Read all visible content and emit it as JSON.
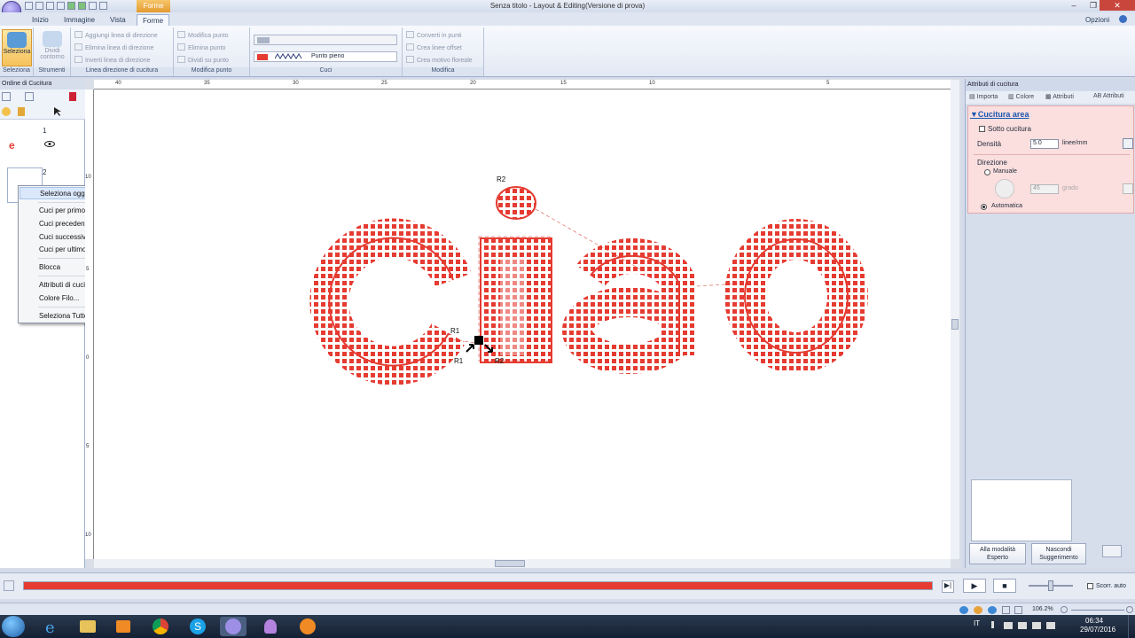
{
  "window": {
    "title": "Senza titolo - Layout & Editing(Versione di prova)",
    "context_tab": "Forme",
    "minimize": "–",
    "restore": "❐",
    "close": "✕"
  },
  "ribbon_tabs": [
    "Inizio",
    "Immagine",
    "Vista",
    "Forme"
  ],
  "options_label": "Opzioni",
  "ribbon": {
    "seleziona": {
      "label": "Seleziona",
      "group": "Seleziona"
    },
    "strumenti": {
      "label": "Dividi contorno",
      "group": "Strumenti"
    },
    "linea_direzione": {
      "items": [
        "Aggiungi linea di direzione",
        "Elimina linea di direzione",
        "Inverti linea di direzione"
      ],
      "group": "Linea direzione di cucitura"
    },
    "modifica_punto": {
      "items": [
        "Modifica punto",
        "Elimina punto",
        "Dividi su punto"
      ],
      "group": "Modifica punto"
    },
    "cuci": {
      "stitch_type": "Punto pieno",
      "group": "Cuci"
    },
    "modifica": {
      "items": [
        "Converti in punti",
        "Crea linee offset",
        "Crea motivo floreale"
      ],
      "group": "Modifica"
    }
  },
  "left_panel": {
    "title": "Ordine di Cucitura",
    "items": [
      {
        "number": "1"
      },
      {
        "number": "2"
      }
    ]
  },
  "context_menu": {
    "items": [
      "Seleziona oggetti",
      "Cuci per primo",
      "Cuci precedente",
      "Cuci successivo",
      "Cuci per ultimo",
      "Blocca",
      "Attributi di cucitura...",
      "Colore Filo...",
      "Seleziona Tutto"
    ]
  },
  "ruler_top": [
    "40",
    "35",
    "30",
    "25",
    "20",
    "15",
    "10",
    "5"
  ],
  "ruler_left": [
    "10",
    "5",
    "0",
    "5",
    "10"
  ],
  "canvas": {
    "text": "ciao",
    "stitch_color": "#e53b31",
    "handles": [
      "R2",
      "R1",
      "R1",
      "R2"
    ]
  },
  "right_panel": {
    "title": "Attributi di cucitura",
    "tabs": [
      "Importa",
      "Colore",
      "Attributi",
      "Attributi"
    ],
    "section": "Cucitura area",
    "sotto_cucitura": "Sotto cucitura",
    "densita_label": "Densità",
    "densita_value": "5.0",
    "densita_unit": "linee/mm",
    "direzione_label": "Direzione",
    "manuale": "Manuale",
    "angle_value": "45",
    "angle_unit": "grado",
    "automatica": "Automatica",
    "btn_esperto": "Alla modalità Esperto",
    "btn_nascondi": "Nascondi Suggerimento"
  },
  "playback": {
    "progress": 1.0,
    "scorr_auto": "Scorr. auto"
  },
  "statusbar": {
    "zoom": "106.2%"
  },
  "taskbar": {
    "lang": "IT",
    "time": "06:34",
    "date": "29/07/2016"
  }
}
